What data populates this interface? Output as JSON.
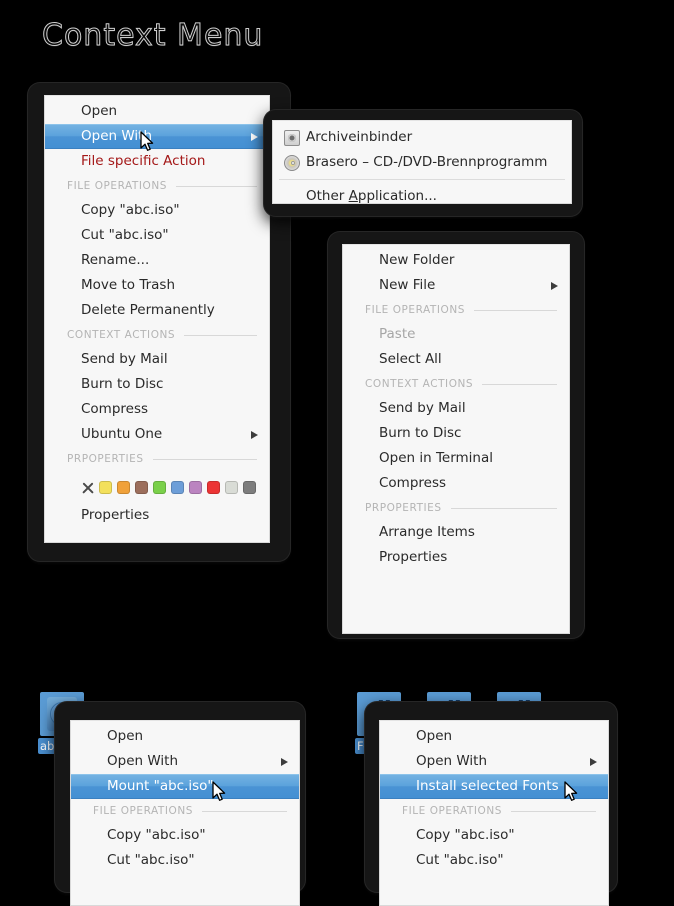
{
  "page": {
    "title": "Context Menu",
    "background_color": "#000000",
    "menu_background": "#f7f7f7",
    "highlight_color": "#4a93d4",
    "accent_red": "#a41818",
    "disabled_color": "#a6a6a6",
    "section_label_color": "#b4b4b4"
  },
  "file_menu": {
    "items": [
      {
        "label": "Open",
        "kind": "item"
      },
      {
        "label": "Open With",
        "kind": "item",
        "selected": true,
        "submenu": true
      },
      {
        "label": "File specific Action",
        "kind": "item",
        "style": "red"
      },
      {
        "label": "FILE OPERATIONS",
        "kind": "section"
      },
      {
        "label": "Copy \"abc.iso\"",
        "kind": "item"
      },
      {
        "label": "Cut \"abc.iso\"",
        "kind": "item"
      },
      {
        "label": "Rename...",
        "kind": "item"
      },
      {
        "label": "Move to Trash",
        "kind": "item"
      },
      {
        "label": "Delete Permanently",
        "kind": "item"
      },
      {
        "label": "CONTEXT ACTIONS",
        "kind": "section"
      },
      {
        "label": "Send by Mail",
        "kind": "item"
      },
      {
        "label": "Burn to Disc",
        "kind": "item"
      },
      {
        "label": "Compress",
        "kind": "item"
      },
      {
        "label": "Ubuntu One",
        "kind": "item",
        "submenu": true
      },
      {
        "label": "PRPOPERTIES",
        "kind": "section"
      },
      {
        "kind": "emblems"
      },
      {
        "label": "Properties",
        "kind": "item"
      }
    ],
    "emblems": [
      {
        "name": "emblem-none",
        "color": "none",
        "icon": "x"
      },
      {
        "name": "emblem-yellow",
        "color": "#f3e05c"
      },
      {
        "name": "emblem-orange",
        "color": "#f0a13a"
      },
      {
        "name": "emblem-brown",
        "color": "#9c6e5c"
      },
      {
        "name": "emblem-green",
        "color": "#7ad04a"
      },
      {
        "name": "emblem-blue",
        "color": "#6d9ed8"
      },
      {
        "name": "emblem-purple",
        "color": "#bb84c0"
      },
      {
        "name": "emblem-red",
        "color": "#ec3434"
      },
      {
        "name": "emblem-light-gray",
        "color": "#d9dcd6"
      },
      {
        "name": "emblem-dark-gray",
        "color": "#7d7d7d"
      }
    ]
  },
  "open_with_submenu": {
    "items": [
      {
        "label": "Archiveinbinder",
        "icon": "archive-icon"
      },
      {
        "label": "Brasero – CD-/DVD-Brennprogramm",
        "icon": "disc-icon"
      },
      {
        "kind": "separator"
      },
      {
        "label_prefix": "Other ",
        "label_accel": "A",
        "label_suffix": "pplication..."
      }
    ]
  },
  "folder_menu": {
    "items": [
      {
        "label": "New Folder",
        "kind": "item"
      },
      {
        "label": "New File",
        "kind": "item",
        "submenu": true
      },
      {
        "label": "FILE OPERATIONS",
        "kind": "section"
      },
      {
        "label": "Paste",
        "kind": "item",
        "disabled": true
      },
      {
        "label": "Select All",
        "kind": "item"
      },
      {
        "label": "CONTEXT ACTIONS",
        "kind": "section"
      },
      {
        "label": "Send by Mail",
        "kind": "item"
      },
      {
        "label": "Burn to Disc",
        "kind": "item"
      },
      {
        "label": "Open in Terminal",
        "kind": "item"
      },
      {
        "label": "Compress",
        "kind": "item"
      },
      {
        "label": "PRPOPERTIES",
        "kind": "section"
      },
      {
        "label": "Arrange Items",
        "kind": "item"
      },
      {
        "label": "Properties",
        "kind": "item"
      }
    ]
  },
  "iso_menu": {
    "desktop_icon": {
      "caption": "abc.i",
      "icon": "disc-file-icon"
    },
    "items": [
      {
        "label": "Open",
        "kind": "item"
      },
      {
        "label": "Open With",
        "kind": "item",
        "submenu": true
      },
      {
        "label": "Mount \"abc.iso\"",
        "kind": "item",
        "selected": true
      },
      {
        "label": "FILE OPERATIONS",
        "kind": "section"
      },
      {
        "label": "Copy \"abc.iso\"",
        "kind": "item"
      },
      {
        "label": "Cut \"abc.iso\"",
        "kind": "item"
      }
    ]
  },
  "font_menu": {
    "desktop_icons": [
      {
        "caption": "Fontfi",
        "icon": "font-file-icon"
      },
      {
        "caption": "",
        "icon": "font-file-icon"
      },
      {
        "caption": "",
        "icon": "font-file-icon"
      }
    ],
    "items": [
      {
        "label": "Open",
        "kind": "item"
      },
      {
        "label": "Open With",
        "kind": "item",
        "submenu": true
      },
      {
        "label": "Install selected Fonts",
        "kind": "item",
        "selected": true
      },
      {
        "label": "FILE OPERATIONS",
        "kind": "section"
      },
      {
        "label": "Copy \"abc.iso\"",
        "kind": "item"
      },
      {
        "label": "Cut \"abc.iso\"",
        "kind": "item"
      }
    ]
  }
}
